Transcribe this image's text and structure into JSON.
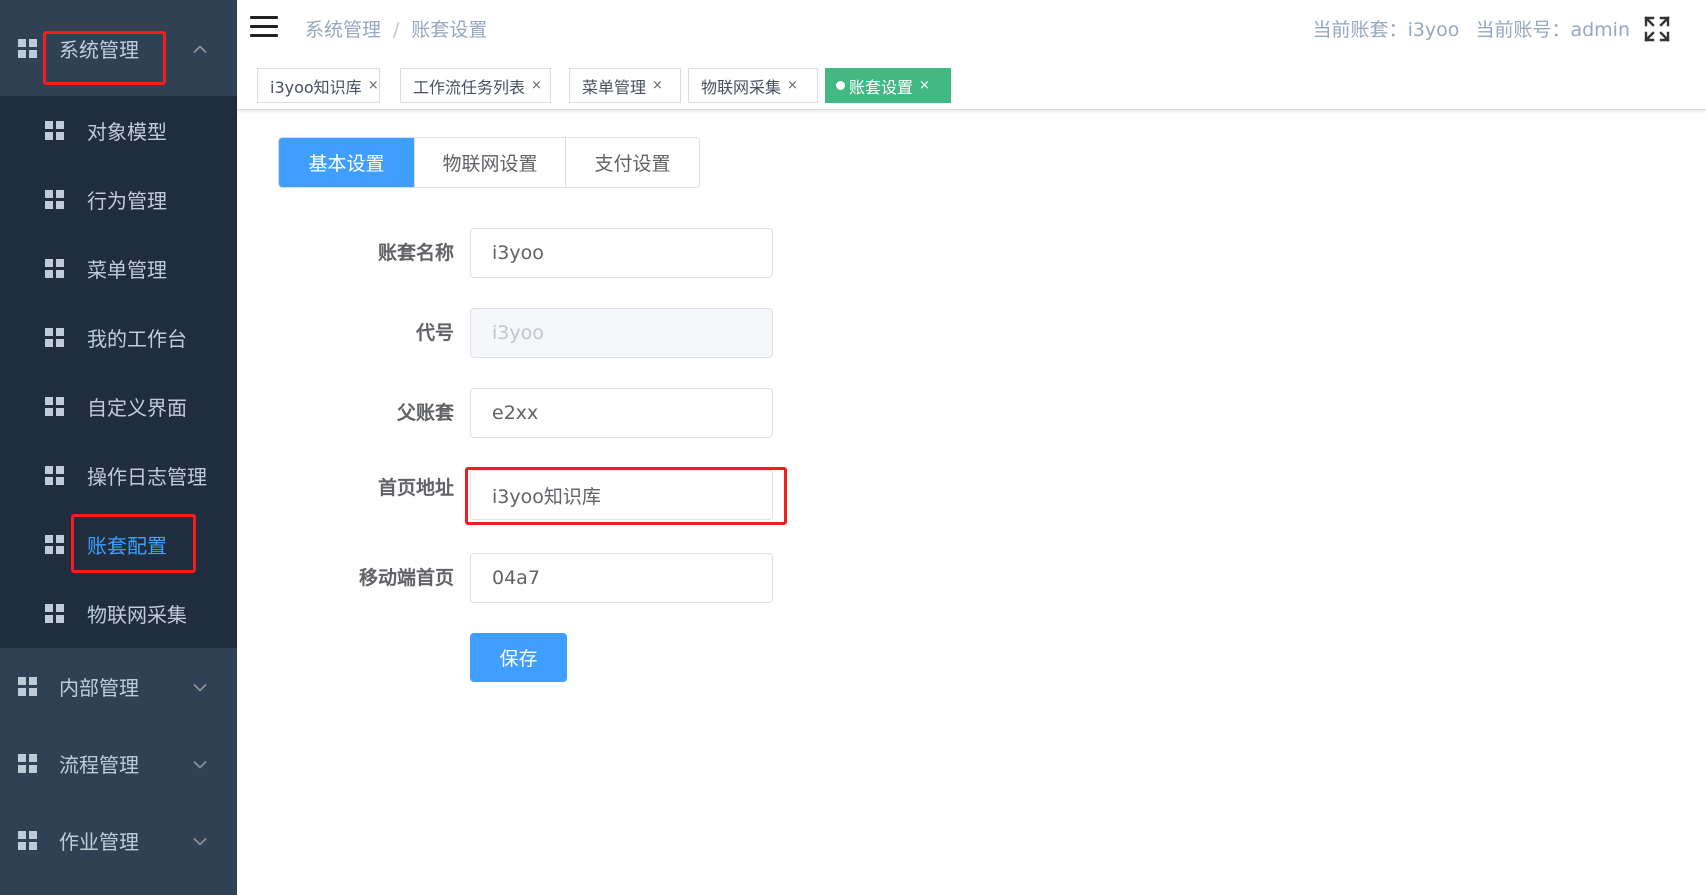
{
  "sidebar": {
    "system_group": {
      "label": "系统管理",
      "items": [
        {
          "label": "对象模型"
        },
        {
          "label": "行为管理"
        },
        {
          "label": "菜单管理"
        },
        {
          "label": "我的工作台"
        },
        {
          "label": "自定义界面"
        },
        {
          "label": "操作日志管理"
        },
        {
          "label": "账套配置",
          "active": true
        },
        {
          "label": "物联网采集"
        }
      ]
    },
    "collapsed_groups": [
      {
        "label": "内部管理"
      },
      {
        "label": "流程管理"
      },
      {
        "label": "作业管理"
      }
    ]
  },
  "header": {
    "breadcrumb": [
      "系统管理",
      "账套设置"
    ],
    "current_account_set_label": "当前账套：",
    "current_account_set_value": "i3yoo",
    "current_user_label": "当前账号：",
    "current_user_value": "admin"
  },
  "tags": [
    {
      "label": "i3yoo知识库"
    },
    {
      "label": "工作流任务列表"
    },
    {
      "label": "菜单管理"
    },
    {
      "label": "物联网采集"
    },
    {
      "label": "账套设置",
      "active": true
    }
  ],
  "tabs": [
    {
      "label": "基本设置",
      "active": true
    },
    {
      "label": "物联网设置"
    },
    {
      "label": "支付设置"
    }
  ],
  "form": {
    "name": {
      "label": "账套名称",
      "value": "i3yoo"
    },
    "code": {
      "label": "代号",
      "value": "i3yoo"
    },
    "parent": {
      "label": "父账套",
      "value": "e2xx"
    },
    "homepage": {
      "label": "首页地址",
      "value": "i3yoo知识库"
    },
    "mobile_home": {
      "label": "移动端首页",
      "value": "04a7"
    },
    "save_label": "保存"
  },
  "colors": {
    "sidebar_bg": "#304156",
    "submenu_bg": "#1f2d3d",
    "primary": "#409eff",
    "active_tag": "#42b983",
    "annotation": "#f01e1e"
  }
}
